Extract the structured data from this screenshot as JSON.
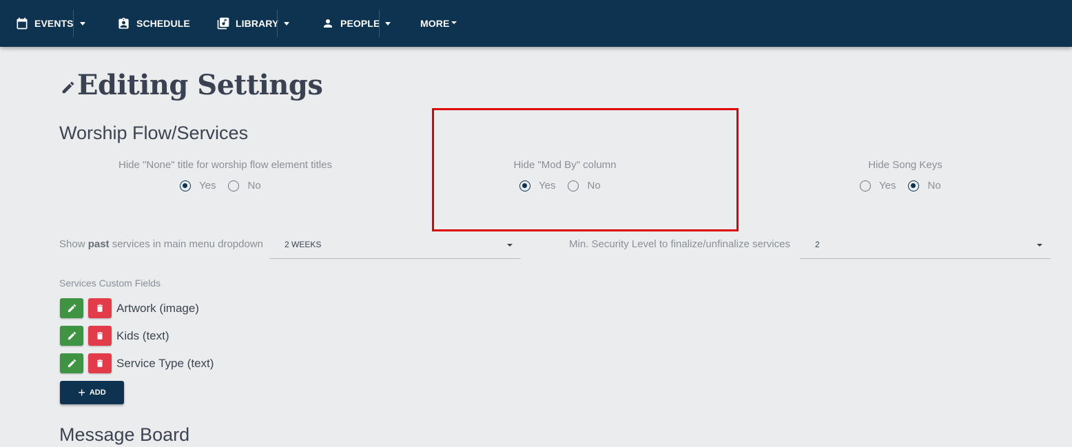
{
  "nav": {
    "events": "EVENTS",
    "schedule": "SCHEDULE",
    "library": "LIBRARY",
    "people": "PEOPLE",
    "more": "MORE"
  },
  "page": {
    "title": "Editing Settings"
  },
  "worship": {
    "section_title": "Worship Flow/Services",
    "settings": [
      {
        "label": "Hide \"None\" title for worship flow element titles",
        "yes": "Yes",
        "no": "No",
        "selected": "Yes"
      },
      {
        "label": "Hide \"Mod By\" column",
        "yes": "Yes",
        "no": "No",
        "selected": "Yes"
      },
      {
        "label": "Hide Song Keys",
        "yes": "Yes",
        "no": "No",
        "selected": "No"
      }
    ],
    "past_services": {
      "label_prefix": "Show ",
      "label_bold": "past",
      "label_suffix": " services in main menu dropdown",
      "value": "2 WEEKS"
    },
    "security": {
      "label": "Min. Security Level to finalize/unfinalize services",
      "value": "2"
    },
    "custom_fields": {
      "title": "Services Custom Fields",
      "items": [
        "Artwork (image)",
        "Kids (text)",
        "Service Type (text)"
      ],
      "add_label": "ADD"
    }
  },
  "message_board": {
    "section_title": "Message Board"
  },
  "colors": {
    "navbar": "#0d3350",
    "edit_button": "#3e9443",
    "delete_button": "#e23c4b",
    "highlight": "#e00000"
  }
}
